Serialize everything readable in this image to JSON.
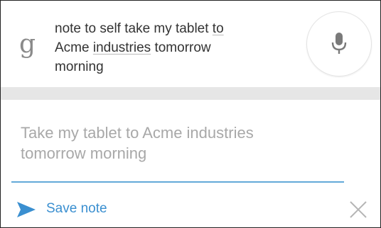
{
  "search": {
    "logo_glyph": "g",
    "query_parts": [
      "note to self take my tablet ",
      "to",
      "Acme ",
      "industries",
      " tomorrow",
      "morning"
    ],
    "mic_icon": "microphone-icon"
  },
  "note": {
    "text_line1": "Take my tablet to Acme industries",
    "text_line2": "tomorrow morning"
  },
  "actions": {
    "save_label": "Save note",
    "save_icon": "send-arrow-icon",
    "close_icon": "close-icon"
  },
  "colors": {
    "accent": "#3a8fd0",
    "input_underline": "#63a9d9",
    "band": "#e6e6e6"
  }
}
